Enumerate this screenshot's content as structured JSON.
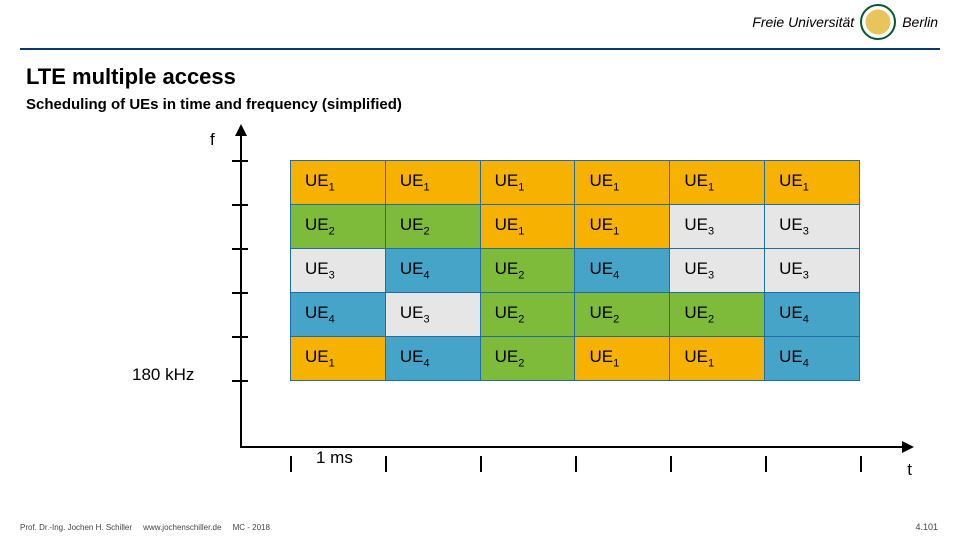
{
  "header": {
    "logo_left": "Freie Universität",
    "logo_right": "Berlin"
  },
  "title": "LTE multiple access",
  "subtitle": "Scheduling of UEs in time and frequency (simplified)",
  "axes": {
    "f_label": "f",
    "t_label": "t"
  },
  "freq_span_label": "180 kHz",
  "time_span_label": "1 ms",
  "ue_labels": {
    "1": "UE",
    "2": "UE",
    "3": "UE",
    "4": "UE"
  },
  "grid_rows": [
    [
      1,
      1,
      1,
      1,
      1,
      1
    ],
    [
      2,
      2,
      1,
      1,
      3,
      3
    ],
    [
      3,
      4,
      2,
      4,
      3,
      3
    ],
    [
      4,
      3,
      2,
      2,
      2,
      4
    ],
    [
      1,
      4,
      2,
      1,
      1,
      4
    ]
  ],
  "footer": {
    "author": "Prof. Dr.-Ing. Jochen H. Schiller",
    "url": "www.jochenschiller.de",
    "course": "MC - 2018",
    "slide_number": "4.101"
  }
}
